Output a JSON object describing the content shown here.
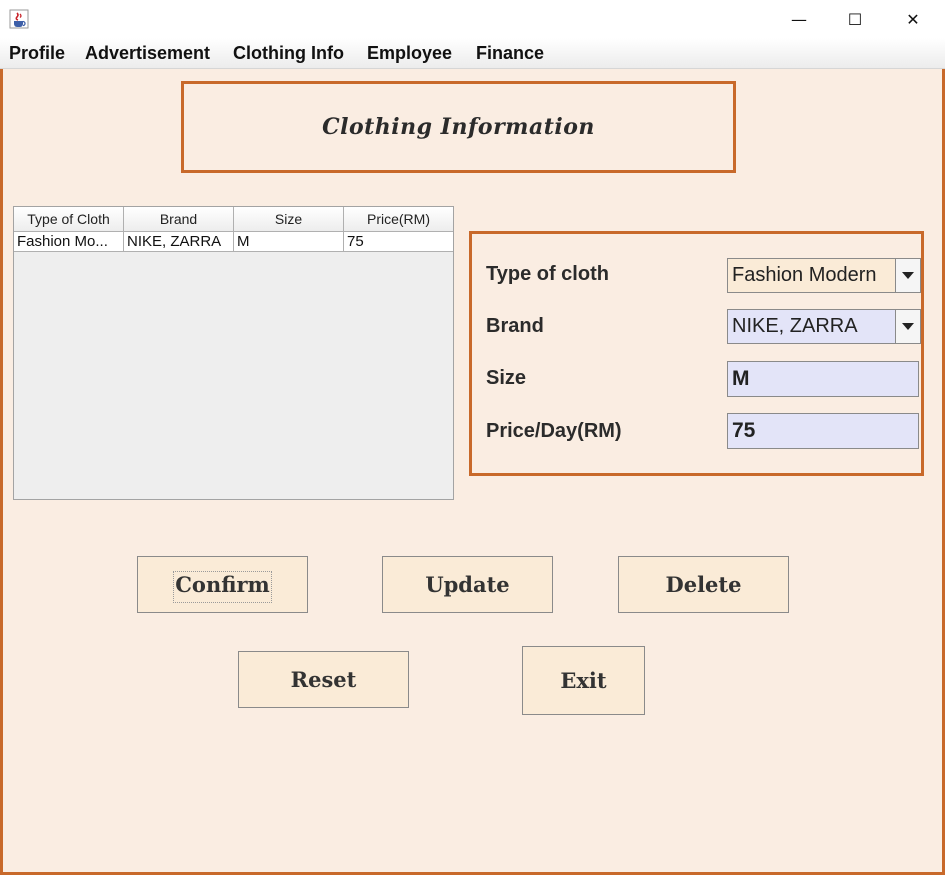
{
  "window": {
    "icon": "java-coffee-cup-icon",
    "minimize_glyph": "—",
    "maximize_glyph": "☐",
    "close_glyph": "✕"
  },
  "menu": [
    "Profile",
    "Advertisement",
    "Clothing Info",
    "Employee",
    "Finance"
  ],
  "header": {
    "title": "Clothing Information"
  },
  "table": {
    "columns": [
      "Type of Cloth",
      "Brand",
      "Size",
      "Price(RM)"
    ],
    "rows": [
      [
        "Fashion Mo...",
        "NIKE, ZARRA",
        "M",
        "75"
      ]
    ]
  },
  "form": {
    "type_label": "Type of cloth",
    "type_value": "Fashion Modern",
    "brand_label": "Brand",
    "brand_value": "NIKE, ZARRA",
    "size_label": "Size",
    "size_value": "M",
    "price_label": "Price/Day(RM)",
    "price_value": "75"
  },
  "buttons": {
    "confirm": "Confirm",
    "update": "Update",
    "delete": "Delete",
    "reset": "Reset",
    "exit": "Exit"
  },
  "colors": {
    "accent_border": "#c8692a",
    "panel_bg": "#faede2",
    "button_bg": "#faebd7",
    "type_combo_bg": "#faebd7",
    "brand_combo_bg": "#e3e4f8",
    "field_bg": "#e3e4f8"
  }
}
